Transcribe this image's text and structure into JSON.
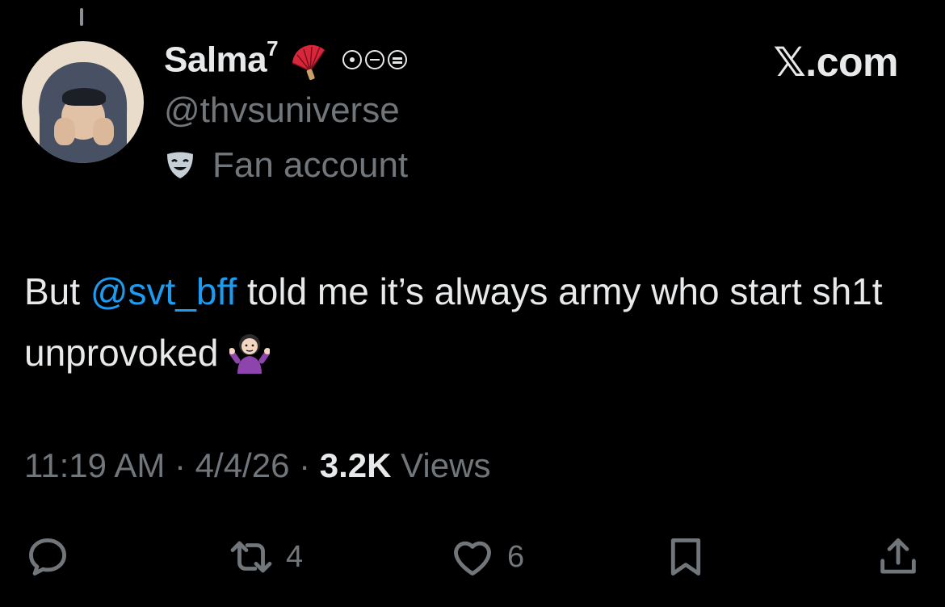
{
  "author": {
    "display_name": "Salma",
    "name_superscript": "7",
    "handle": "@thvsuniverse",
    "label": "Fan account"
  },
  "brand": "𝕏.com",
  "tweet": {
    "text_before": "But ",
    "mention": "@svt_bff",
    "text_after": " told me it’s always army who start sh1t unprovoked"
  },
  "meta": {
    "time": "11:19 AM",
    "sep1": " · ",
    "date": "4/4/26",
    "sep2": " · ",
    "view_count": "3.2K",
    "views_label": " Views"
  },
  "actions": {
    "reply": {
      "icon": "reply-icon",
      "count": ""
    },
    "retweet": {
      "icon": "retweet-icon",
      "count": "4"
    },
    "like": {
      "icon": "heart-icon",
      "count": "6"
    },
    "bookmark": {
      "icon": "bookmark-icon",
      "count": ""
    },
    "share": {
      "icon": "share-icon",
      "count": ""
    }
  },
  "colors": {
    "background": "#000000",
    "text": "#e7e9ea",
    "secondary": "#71767b",
    "link": "#1d9bf0"
  }
}
